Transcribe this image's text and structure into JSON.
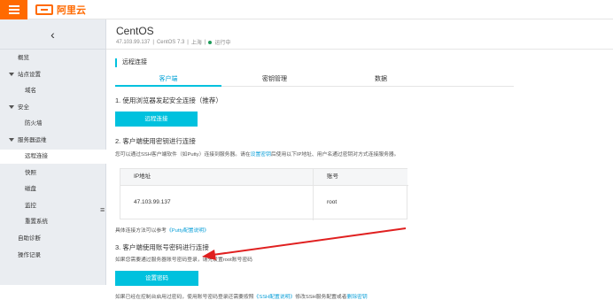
{
  "header": {
    "logo_text": "阿里云",
    "brand_color": "#ff6a00"
  },
  "sidebar": {
    "collapse_icon": "‹",
    "items": [
      {
        "label": "概览"
      },
      {
        "label": "站点设置"
      },
      {
        "label": "域名"
      },
      {
        "label": "安全"
      },
      {
        "label": "防火墙"
      },
      {
        "label": "服务器运维"
      },
      {
        "label": "远程连接"
      },
      {
        "label": "快照"
      },
      {
        "label": "磁盘"
      },
      {
        "label": "监控"
      },
      {
        "label": "重置系统"
      },
      {
        "label": "自助诊断"
      },
      {
        "label": "操作记录"
      }
    ],
    "handle_icon": "≡"
  },
  "server": {
    "title": "CentOS",
    "ip": "47.103.99.137",
    "os": "CentOS 7.3",
    "region": "上海",
    "status": "运行中",
    "status_color": "#1e9b5a",
    "sep": "|"
  },
  "main": {
    "section_title": "远程连接",
    "tabs": [
      {
        "label": "客户端"
      },
      {
        "label": "密钥管理"
      },
      {
        "label": "数据"
      }
    ],
    "step1": {
      "title": "1. 使用浏览器发起安全连接（推荐）",
      "button": "远程连接"
    },
    "step2": {
      "title": "2. 客户端使用密钥进行连接",
      "desc_before": "您可以通过SSH客户端软件（如Putty）连接到服务器。请在",
      "desc_link": "设置密钥",
      "desc_after": "后使用以下IP地址、用户名通过密钥对方式连接服务器。",
      "table": {
        "headers": [
          "IP地址",
          "账号"
        ],
        "row": [
          "47.103.99.137",
          "root"
        ]
      },
      "ref_before": "具体连接方法可以参考",
      "ref_link": "《Putty配置说明》"
    },
    "step3": {
      "title": "3. 客户端使用账号密码进行连接",
      "desc": "如果您需要通过服务器账号密码登录，请先设置root账号密码",
      "button": "设置密码",
      "note_before": "如果已经在控制台启用过密码，使用账号密码登录还需要按照",
      "note_link1": "《SSH配置说明》",
      "note_mid": "修改SSH服务配置或者",
      "note_link2": "删除密钥"
    },
    "accent_color": "#00c1de",
    "arrow_color": "#e02020"
  }
}
